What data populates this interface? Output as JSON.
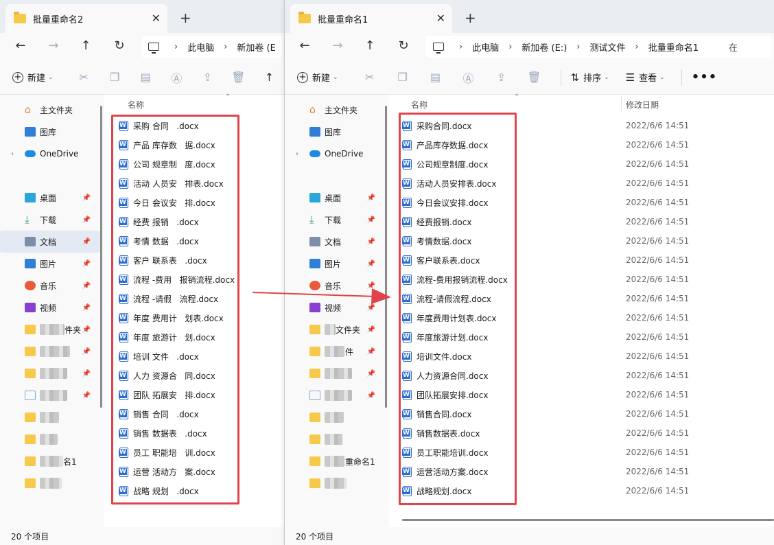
{
  "window_left": {
    "tab_title": "批量重命名2",
    "address": [
      "此电脑",
      "新加卷 (E"
    ],
    "toolbar": {
      "new_label": "新建"
    },
    "column_name": "名称",
    "files": [
      "采购 合同   .docx",
      "产品 库存数   据.docx",
      "公司 规章制   度.docx",
      "活动 人员安   排表.docx",
      "今日 会议安   排.docx",
      "经费 报销   .docx",
      "考情 数据   .docx",
      "客户 联系表   .docx",
      "流程 -费用   报销流程.docx",
      "流程 -请假   流程.docx",
      "年度 费用计   划表.docx",
      "年度 旅游计   划.docx",
      "培训 文件   .docx",
      "人力 资源合   同.docx",
      "团队 拓展安   排.docx",
      "销售 合同   .docx",
      "销售 数据表   .docx",
      "员工 职能培   训.docx",
      "运营 活动方   案.docx",
      "战略 规划   .docx"
    ],
    "status": "20 个项目"
  },
  "window_right": {
    "tab_title": "批量重命名1",
    "address": [
      "此电脑",
      "新加卷 (E:)",
      "测试文件",
      "批量重命名1",
      "在"
    ],
    "toolbar": {
      "new_label": "新建",
      "sort_label": "排序",
      "view_label": "查看",
      "more": "•••"
    },
    "column_name": "名称",
    "column_date": "修改日期",
    "files": [
      "采购合同.docx",
      "产品库存数据.docx",
      "公司规章制度.docx",
      "活动人员安排表.docx",
      "今日会议安排.docx",
      "经费报销.docx",
      "考情数据.docx",
      "客户联系表.docx",
      "流程-费用报销流程.docx",
      "流程-请假流程.docx",
      "年度费用计划表.docx",
      "年度旅游计划.docx",
      "培训文件.docx",
      "人力资源合同.docx",
      "团队拓展安排.docx",
      "销售合同.docx",
      "销售数据表.docx",
      "员工职能培训.docx",
      "运营活动方案.docx",
      "战略规划.docx"
    ],
    "date_value": "2022/6/6 14:51",
    "status": "20 个项目"
  },
  "sidebar": {
    "home": "主文件夹",
    "gallery": "图库",
    "onedrive": "OneDrive",
    "desktop": "桌面",
    "downloads": "下载",
    "documents": "文档",
    "pictures": "图片",
    "music": "音乐",
    "videos": "视频",
    "blur_left": [
      "件夹",
      "",
      "",
      "",
      "",
      "",
      "名1",
      ""
    ],
    "blur_right": [
      "文件夹",
      "件",
      "",
      "",
      "",
      "",
      "重命名1",
      ""
    ]
  },
  "colors": {
    "red_box": "#e0444a",
    "word_blue": "#2b6cd0",
    "folder": "#f7c94b"
  }
}
